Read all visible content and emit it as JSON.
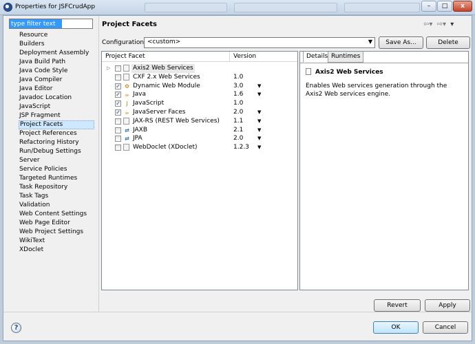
{
  "window": {
    "title": "Properties for JSFCrudApp",
    "controls": {
      "minimize": "–",
      "maximize": "□",
      "close": "x"
    }
  },
  "sidebar": {
    "filter_placeholder": "type filter text",
    "items": [
      {
        "label": "Resource"
      },
      {
        "label": "Builders"
      },
      {
        "label": "Deployment Assembly"
      },
      {
        "label": "Java Build Path"
      },
      {
        "label": "Java Code Style"
      },
      {
        "label": "Java Compiler"
      },
      {
        "label": "Java Editor"
      },
      {
        "label": "Javadoc Location"
      },
      {
        "label": "JavaScript"
      },
      {
        "label": "JSP Fragment"
      },
      {
        "label": "Project Facets",
        "selected": true
      },
      {
        "label": "Project References"
      },
      {
        "label": "Refactoring History"
      },
      {
        "label": "Run/Debug Settings"
      },
      {
        "label": "Server"
      },
      {
        "label": "Service Policies"
      },
      {
        "label": "Targeted Runtimes"
      },
      {
        "label": "Task Repository"
      },
      {
        "label": "Task Tags"
      },
      {
        "label": "Validation"
      },
      {
        "label": "Web Content Settings"
      },
      {
        "label": "Web Page Editor"
      },
      {
        "label": "Web Project Settings"
      },
      {
        "label": "WikiText"
      },
      {
        "label": "XDoclet"
      }
    ]
  },
  "page": {
    "title": "Project Facets",
    "configuration_label": "Configuration:",
    "configuration_value": "<custom>",
    "save_as_label": "Save As...",
    "delete_label": "Delete"
  },
  "facets": {
    "header_facet": "Project Facet",
    "header_version": "Version",
    "rows": [
      {
        "name": "Axis2 Web Services",
        "version": "",
        "checked": false,
        "has_dropdown": false,
        "icon": "generic-icon",
        "expandable": true,
        "selected": true
      },
      {
        "name": "CXF 2.x Web Services",
        "version": "1.0",
        "checked": false,
        "has_dropdown": false,
        "icon": "generic-icon"
      },
      {
        "name": "Dynamic Web Module",
        "version": "3.0",
        "checked": true,
        "has_dropdown": true,
        "icon": "web-module-icon"
      },
      {
        "name": "Java",
        "version": "1.6",
        "checked": true,
        "has_dropdown": true,
        "icon": "java-icon"
      },
      {
        "name": "JavaScript",
        "version": "1.0",
        "checked": true,
        "has_dropdown": false,
        "icon": "javascript-icon"
      },
      {
        "name": "JavaServer Faces",
        "version": "2.0",
        "checked": true,
        "has_dropdown": true,
        "icon": "jsf-icon"
      },
      {
        "name": "JAX-RS (REST Web Services)",
        "version": "1.1",
        "checked": false,
        "has_dropdown": true,
        "icon": "generic-icon"
      },
      {
        "name": "JAXB",
        "version": "2.1",
        "checked": false,
        "has_dropdown": true,
        "icon": "jaxb-icon"
      },
      {
        "name": "JPA",
        "version": "2.0",
        "checked": false,
        "has_dropdown": true,
        "icon": "jpa-icon"
      },
      {
        "name": "WebDoclet (XDoclet)",
        "version": "1.2.3",
        "checked": false,
        "has_dropdown": true,
        "icon": "generic-icon"
      }
    ]
  },
  "details": {
    "tabs": [
      "Details",
      "Runtimes"
    ],
    "title": "Axis2 Web Services",
    "description": "Enables Web services generation through the Axis2 Web services engine."
  },
  "buttons": {
    "revert": "Revert",
    "apply": "Apply",
    "ok": "OK",
    "cancel": "Cancel",
    "help": "?"
  }
}
